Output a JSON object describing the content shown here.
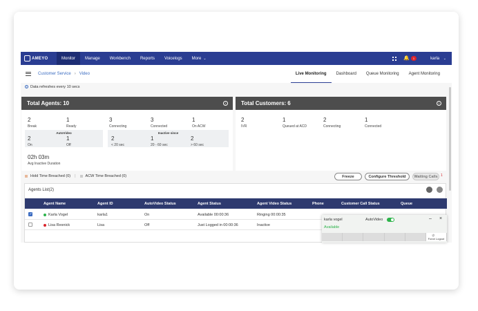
{
  "nav": {
    "logo_text": "AMEYO",
    "items": [
      "Monitor",
      "Manage",
      "Workbench",
      "Reports",
      "Voicelogs",
      "More"
    ],
    "more_chevron": "chevron-down-icon",
    "notification_count": "1",
    "user": "karla"
  },
  "breadcrumb": {
    "campaign": "Customer Service",
    "sub": "Video"
  },
  "tabs": [
    "Live Monitoring",
    "Dashboard",
    "Queue Monitoring",
    "Agent Monitoring"
  ],
  "refresh_text": "Data refreshes every 10 secs",
  "agents_panel": {
    "title": "Total Agents:",
    "total": "10",
    "stats": [
      {
        "value": "2",
        "label": "Break"
      },
      {
        "value": "1",
        "label": "Ready"
      },
      {
        "value": "3",
        "label": "Connecting"
      },
      {
        "value": "3",
        "label": "Connected"
      },
      {
        "value": "1",
        "label": "On ACW"
      }
    ],
    "autovideo": {
      "title": "AutoVideo",
      "stats": [
        {
          "value": "2",
          "label": "On"
        },
        {
          "value": "1",
          "label": "Off"
        }
      ]
    },
    "inactive": {
      "title": "Inactive since",
      "stats": [
        {
          "value": "2",
          "label": "< 20 sec"
        },
        {
          "value": "1",
          "label": "20 - 60 sec"
        },
        {
          "value": "2",
          "label": "> 60 sec"
        }
      ]
    },
    "avg": {
      "value": "02h 03m",
      "label": "Avg Inactive Duration"
    }
  },
  "customers_panel": {
    "title": "Total Customers:",
    "total": "6",
    "stats": [
      {
        "value": "2",
        "label": "IVR"
      },
      {
        "value": "1",
        "label": "Queued at ACD"
      },
      {
        "value": "2",
        "label": "Connecting"
      },
      {
        "value": "1",
        "label": "Connected"
      }
    ]
  },
  "legend": {
    "hold": "Hold Time Breached (0)",
    "acw": "ACW Time Breached (0)",
    "hold_color": "#e8b89a",
    "acw_color": "#cccccc"
  },
  "buttons": {
    "freeze": "Freeze",
    "configure": "Configure Threshold",
    "waiting": "Waiting Calls",
    "waiting_count": "1"
  },
  "agents_list": {
    "title": "Agents List(2)",
    "columns": [
      "Agent Name",
      "Agent ID",
      "AutoVideo Status",
      "Agent Status",
      "Agent Video Status",
      "Phone",
      "Customer Call Status",
      "Queue"
    ],
    "rows": [
      {
        "name": "Karla Vogel",
        "id": "karla1",
        "autovideo": "On",
        "status": "Available 00:00:36",
        "video_status": "Ringing 00:00:35",
        "checked": true,
        "dot": "#2cb34a"
      },
      {
        "name": "Lisa Resnick",
        "id": "Lisa",
        "autovideo": "Off",
        "status": "Just Logged in 00:00:36",
        "video_status": "Inactive",
        "checked": false,
        "dot": "#d9242c"
      }
    ]
  },
  "widget": {
    "user": "karla vogel",
    "autovideo_label": "AutoVideo",
    "status": "Available",
    "status_color": "#2cb34a",
    "force_logout": "Force Logout"
  }
}
